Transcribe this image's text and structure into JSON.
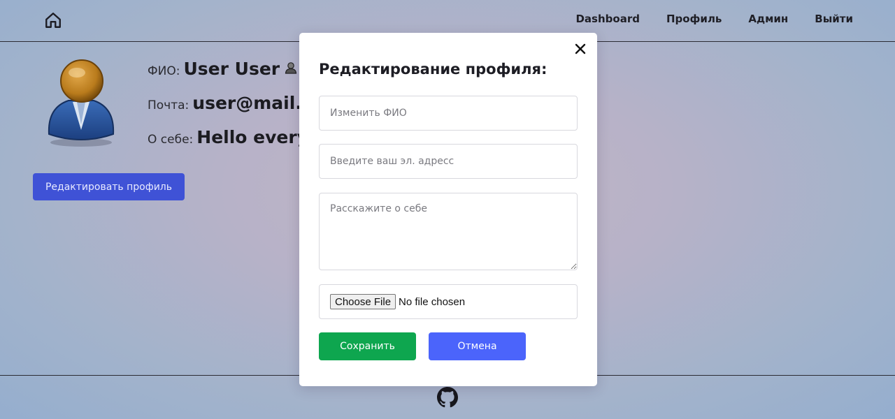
{
  "nav": {
    "home_icon": "home-icon",
    "links": [
      "Dashboard",
      "Профиль",
      "Админ",
      "Выйти"
    ]
  },
  "profile": {
    "avatar_icon": "user-avatar-icon",
    "name_label": "ФИО:",
    "name_value": "User User",
    "email_label": "Почта:",
    "email_value": "user@mail.",
    "about_label": "О себе:",
    "about_value": "Hello every",
    "edit_button": "Редактировать профиль"
  },
  "modal": {
    "title": "Редактирование профиля:",
    "close_icon": "close-icon",
    "name_placeholder": "Изменить ФИО",
    "email_placeholder": "Введите ваш эл. адресс",
    "about_placeholder": "Расскажите о себе",
    "file_button": "Choose File",
    "file_status": "No file chosen",
    "save_button": "Сохранить",
    "cancel_button": "Отмена"
  },
  "footer": {
    "github_icon": "github-icon"
  },
  "colors": {
    "edit_button": "#3f52d6",
    "save_button": "#0ea64f",
    "cancel_button": "#4b64fb"
  }
}
